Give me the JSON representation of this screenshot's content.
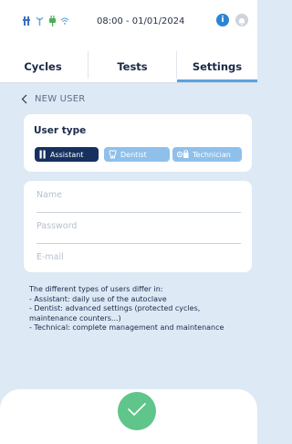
{
  "status": {
    "time": "08:00 - 01/01/2024",
    "icons": [
      "usb-icon",
      "antenna-icon",
      "plug-icon",
      "wifi-icon"
    ],
    "info_label": "i"
  },
  "tabs": [
    {
      "label": "Cycles",
      "active": false
    },
    {
      "label": "Tests",
      "active": false
    },
    {
      "label": "Settings",
      "active": true
    }
  ],
  "page": {
    "back_label": "NEW USER"
  },
  "user_type": {
    "title": "User type",
    "options": [
      {
        "label": "Assistant",
        "icon": "assistant-icon",
        "selected": true
      },
      {
        "label": "Dentist",
        "icon": "tooth-icon",
        "selected": false
      },
      {
        "label": "Technician",
        "icon": "technician-icon",
        "selected": false
      }
    ]
  },
  "form": {
    "name_placeholder": "Name",
    "password_placeholder": "Password",
    "email_placeholder": "E-mail"
  },
  "info": {
    "lines": [
      "The different types of users differ in:",
      "- Assistant: daily use of the autoclave",
      "- Dentist: advanced settings (protected cycles, maintenance counters...)",
      "- Technical: complete management and maintenance"
    ]
  },
  "colors": {
    "background": "#dde9f5",
    "primary_dark": "#16305f",
    "chip_inactive": "#8ec0ea",
    "accent": "#5aa2e0",
    "confirm": "#5fc58a",
    "info": "#2d84d3"
  }
}
